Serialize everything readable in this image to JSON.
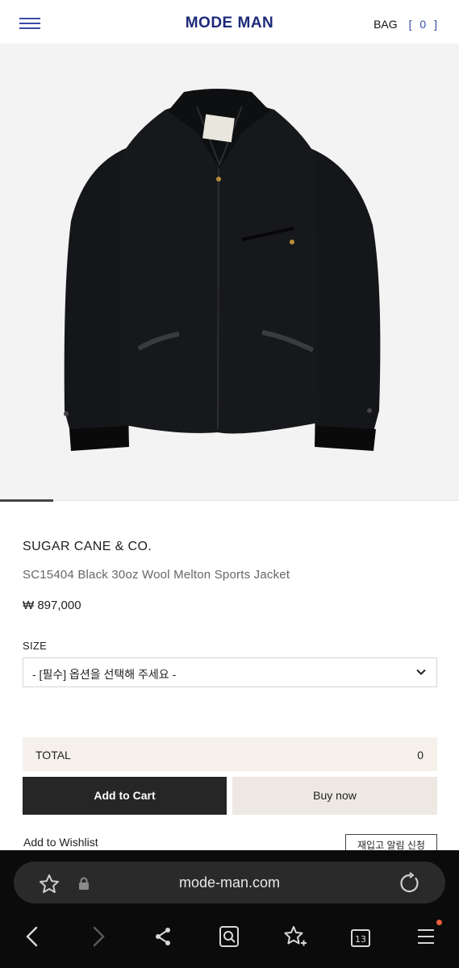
{
  "header": {
    "logo": "MODE MAN",
    "bag_label": "BAG",
    "bag_count": "[ 0 ]"
  },
  "product": {
    "brand": "SUGAR CANE & CO.",
    "name": "SC15404 Black 30oz Wool Melton Sports Jacket",
    "price": "₩ 897,000",
    "size_label": "SIZE",
    "size_option": "- [필수] 옵션을 선택해 주세요 -",
    "total_label": "TOTAL",
    "total_value": "0"
  },
  "actions": {
    "add_to_cart": "Add to Cart",
    "buy_now": "Buy now",
    "wishlist": "Add to Wishlist",
    "restock": "재입고 알림 신청"
  },
  "browser": {
    "url": "mode-man.com",
    "tab_count": "13"
  },
  "icons": {
    "menu": "hamburger-icon",
    "chevron": "chevron-down-icon",
    "star": "star-icon",
    "lock": "lock-icon",
    "reload": "reload-icon",
    "back": "back-arrow-icon",
    "forward": "forward-arrow-icon",
    "share": "share-icon",
    "find": "search-page-icon",
    "bookmark": "bookmark-add-icon",
    "tabs": "tabs-icon",
    "more": "menu-lines-icon"
  },
  "colors": {
    "brand_blue": "#1d2a7a",
    "accent_blue": "#3b4ba8",
    "cart_button": "#262626",
    "buy_button": "#ede8e1",
    "total_bg": "#f5f1ea",
    "notification_dot": "#e8603c"
  }
}
